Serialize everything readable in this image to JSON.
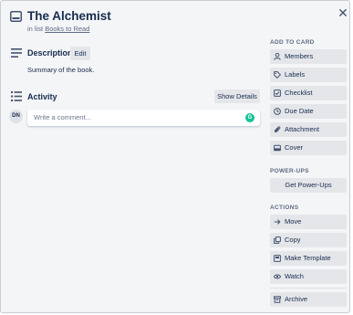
{
  "card": {
    "title": "The Alchemist",
    "in_list_prefix": "in list",
    "list_name": "Books to Read"
  },
  "description": {
    "heading": "Description",
    "edit_label": "Edit",
    "text": "Summary of the book."
  },
  "activity": {
    "heading": "Activity",
    "show_details_label": "Show Details",
    "avatar_initials": "DN",
    "comment_placeholder": "Write a comment..."
  },
  "sidebar": {
    "add_to_card_heading": "ADD TO CARD",
    "add_to_card": [
      {
        "label": "Members",
        "icon": "person-icon"
      },
      {
        "label": "Labels",
        "icon": "tag-icon"
      },
      {
        "label": "Checklist",
        "icon": "checkbox-icon"
      },
      {
        "label": "Due Date",
        "icon": "clock-icon"
      },
      {
        "label": "Attachment",
        "icon": "paperclip-icon"
      },
      {
        "label": "Cover",
        "icon": "cover-icon"
      }
    ],
    "powerups_heading": "POWER-UPS",
    "get_powerups_label": "Get Power-Ups",
    "actions_heading": "ACTIONS",
    "actions": [
      {
        "label": "Move",
        "icon": "arrow-right-icon"
      },
      {
        "label": "Copy",
        "icon": "copy-icon"
      },
      {
        "label": "Make Template",
        "icon": "template-icon"
      },
      {
        "label": "Watch",
        "icon": "eye-icon"
      },
      {
        "label": "Archive",
        "icon": "archive-icon"
      }
    ]
  },
  "colors": {
    "background": "#f4f5f7",
    "button": "#e4e6ea",
    "text": "#172b4d",
    "muted": "#5e6c84",
    "grammarly": "#15c39a"
  }
}
